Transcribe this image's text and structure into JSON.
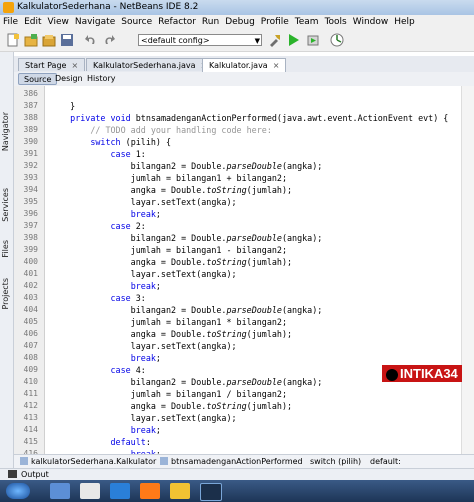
{
  "window": {
    "title": "KalkulatorSederhana - NetBeans IDE 8.2"
  },
  "menu": [
    "File",
    "Edit",
    "View",
    "Navigate",
    "Source",
    "Refactor",
    "Run",
    "Debug",
    "Profile",
    "Team",
    "Tools",
    "Window",
    "Help"
  ],
  "toolbar": {
    "config_value": "<default config>",
    "icons": [
      "new-file-icon",
      "new-project-icon",
      "open-project-icon",
      "save-all-icon",
      "undo-icon",
      "redo-icon",
      "build-icon",
      "clean-build-icon",
      "run-icon",
      "debug-icon",
      "profile-icon"
    ]
  },
  "side_panels": [
    "Navigator",
    "Services",
    "Files",
    "Projects"
  ],
  "tabs": [
    {
      "label": "Start Page",
      "active": false
    },
    {
      "label": "KalkulatorSederhana.java",
      "active": false
    },
    {
      "label": "Kalkulator.java",
      "active": true
    }
  ],
  "editor_modes": [
    "Source",
    "Design",
    "History"
  ],
  "code_lines": [
    {
      "num": "386",
      "text": ""
    },
    {
      "num": "387",
      "text": "    }"
    },
    {
      "num": "388",
      "text": "    private void btnsamadenganActionPerformed(java.awt.event.ActionEvent evt) {"
    },
    {
      "num": "389",
      "text": "        // TODO add your handling code here:"
    },
    {
      "num": "390",
      "text": "        switch (pilih) {"
    },
    {
      "num": "391",
      "text": "            case 1:"
    },
    {
      "num": "392",
      "text": "                bilangan2 = Double.parseDouble(angka);"
    },
    {
      "num": "393",
      "text": "                jumlah = bilangan1 + bilangan2;"
    },
    {
      "num": "394",
      "text": "                angka = Double.toString(jumlah);"
    },
    {
      "num": "395",
      "text": "                layar.setText(angka);"
    },
    {
      "num": "396",
      "text": "                break;"
    },
    {
      "num": "397",
      "text": "            case 2:"
    },
    {
      "num": "398",
      "text": "                bilangan2 = Double.parseDouble(angka);"
    },
    {
      "num": "399",
      "text": "                jumlah = bilangan1 - bilangan2;"
    },
    {
      "num": "400",
      "text": "                angka = Double.toString(jumlah);"
    },
    {
      "num": "401",
      "text": "                layar.setText(angka);"
    },
    {
      "num": "402",
      "text": "                break;"
    },
    {
      "num": "403",
      "text": "            case 3:"
    },
    {
      "num": "404",
      "text": "                bilangan2 = Double.parseDouble(angka);"
    },
    {
      "num": "405",
      "text": "                jumlah = bilangan1 * bilangan2;"
    },
    {
      "num": "406",
      "text": "                angka = Double.toString(jumlah);"
    },
    {
      "num": "407",
      "text": "                layar.setText(angka);"
    },
    {
      "num": "408",
      "text": "                break;"
    },
    {
      "num": "409",
      "text": "            case 4:"
    },
    {
      "num": "410",
      "text": "                bilangan2 = Double.parseDouble(angka);"
    },
    {
      "num": "411",
      "text": "                jumlah = bilangan1 / bilangan2;"
    },
    {
      "num": "412",
      "text": "                angka = Double.toString(jumlah);"
    },
    {
      "num": "413",
      "text": "                layar.setText(angka);"
    },
    {
      "num": "414",
      "text": "                break;"
    },
    {
      "num": "415",
      "text": "            default:"
    },
    {
      "num": "416",
      "text": "                break;"
    }
  ],
  "breadcrumb": [
    "kalkulatorSederhana.Kalkulator",
    "btnsamadenganActionPerformed",
    "switch (pilih)",
    "default:"
  ],
  "output_label": "Output",
  "watermark": "INTIKA34",
  "colors": {
    "keyword": "#0000e6",
    "comment": "#969696",
    "watermark_bg": "#c81414"
  }
}
